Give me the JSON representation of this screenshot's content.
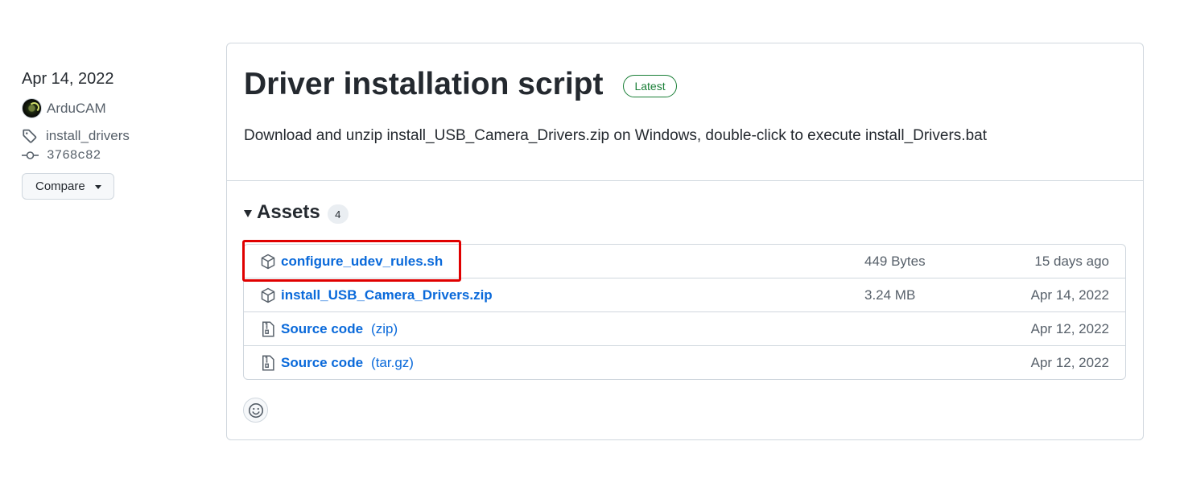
{
  "sidebar": {
    "date": "Apr 14, 2022",
    "author": "ArduCAM",
    "tag": "install_drivers",
    "commit": "3768c82",
    "compare_label": "Compare"
  },
  "release": {
    "title": "Driver installation script",
    "badge": "Latest",
    "description": "Download and unzip install_USB_Camera_Drivers.zip on Windows, double-click to execute install_Drivers.bat"
  },
  "assets": {
    "label": "Assets",
    "count": "4",
    "items": [
      {
        "name": "configure_udev_rules.sh",
        "suffix": "",
        "size": "449 Bytes",
        "date": "15 days ago",
        "icon": "package-icon"
      },
      {
        "name": "install_USB_Camera_Drivers.zip",
        "suffix": "",
        "size": "3.24 MB",
        "date": "Apr 14, 2022",
        "icon": "package-icon"
      },
      {
        "name": "Source code",
        "suffix": "(zip)",
        "size": "",
        "date": "Apr 12, 2022",
        "icon": "file-zip-icon"
      },
      {
        "name": "Source code",
        "suffix": "(tar.gz)",
        "size": "",
        "date": "Apr 12, 2022",
        "icon": "file-zip-icon"
      }
    ]
  },
  "colors": {
    "link": "#0969da",
    "badge_green": "#1a7f37",
    "highlight_red": "#e00000",
    "border": "#d0d7de"
  }
}
